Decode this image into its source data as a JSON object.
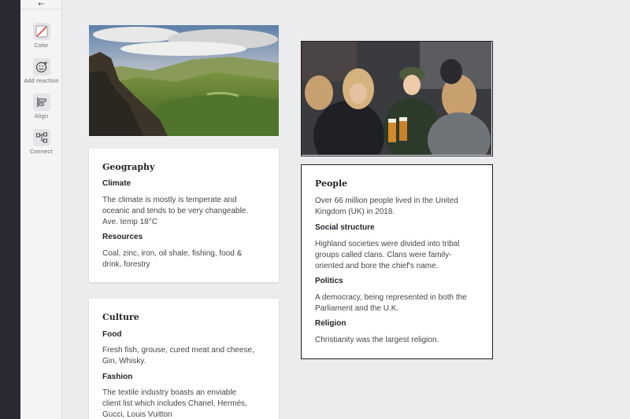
{
  "toolbar": {
    "items": [
      {
        "label": "Color",
        "icon": "color-swatch-icon"
      },
      {
        "label": "Add reaction",
        "icon": "add-reaction-icon"
      },
      {
        "label": "Align",
        "icon": "align-icon"
      },
      {
        "label": "Connect",
        "icon": "connect-icon"
      }
    ]
  },
  "geography": {
    "title": "Geography",
    "sections": [
      {
        "heading": "Climate",
        "lines": [
          "The climate is mostly is temperate and",
          "oceanic and tends to be very changeable.",
          "Ave. temp 18°C"
        ]
      },
      {
        "heading": "Resources",
        "lines": [
          "Coal, zinc, iron, oil shale, fishing, food &",
          "drink, forestry"
        ]
      }
    ]
  },
  "culture": {
    "title": "Culture",
    "sections": [
      {
        "heading": "Food",
        "lines": [
          "Fresh fish, grouse, cured meat and cheese,",
          "Gin, Whisky."
        ]
      },
      {
        "heading": "Fashion",
        "lines": [
          "The textile industry boasts an enviable",
          "client list which includes Chanel, Hermés,",
          "Gucci, Louis Vuitton"
        ]
      }
    ]
  },
  "people": {
    "title": "People",
    "intro": [
      "Over 66 million people lived in the United",
      "Kingdom (UK) in 2018."
    ],
    "sections": [
      {
        "heading": "Social structure",
        "lines": [
          "Highland societies were divided into tribal",
          "groups called clans. Clans were family-",
          "oriented and bore the chief's name."
        ]
      },
      {
        "heading": "Politics",
        "lines": [
          "A democracy, being represented in both the",
          "Parliament and the U.K."
        ]
      },
      {
        "heading": "Religion",
        "lines": [
          "Christianity was the largest religion."
        ]
      }
    ]
  }
}
